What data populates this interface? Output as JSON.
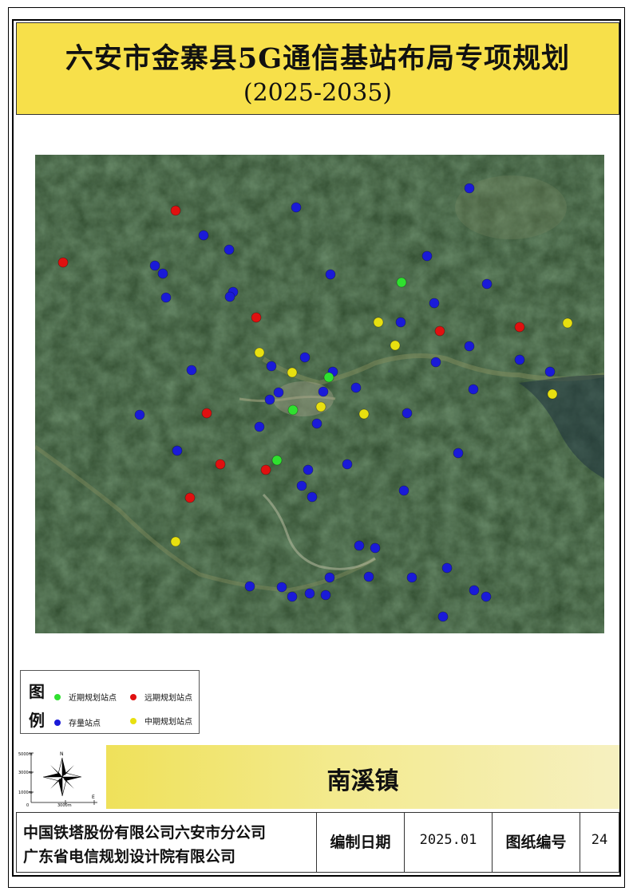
{
  "title": {
    "main": "六安市金寨县5G通信基站布局专项规划",
    "period": "(2025-2035)"
  },
  "colors": {
    "title_bg": "#f7e04a",
    "near_term": "#2fe02f",
    "long_term": "#e01010",
    "existing": "#1a1ad8",
    "mid_term": "#e8e010"
  },
  "legend": {
    "heading_top": "图",
    "heading_bottom": "例",
    "near_term": "近期规划站点",
    "long_term": "远期规划站点",
    "existing": "存量站点",
    "mid_term": "中期规划站点"
  },
  "sites": {
    "existing": [
      [
        588,
        236
      ],
      [
        371,
        260
      ],
      [
        255,
        295
      ],
      [
        287,
        313
      ],
      [
        194,
        333
      ],
      [
        204,
        343
      ],
      [
        414,
        344
      ],
      [
        535,
        321
      ],
      [
        610,
        356
      ],
      [
        208,
        373
      ],
      [
        292,
        366
      ],
      [
        288,
        372
      ],
      [
        544,
        380
      ],
      [
        502,
        404
      ],
      [
        588,
        434
      ],
      [
        382,
        448
      ],
      [
        340,
        459
      ],
      [
        240,
        464
      ],
      [
        546,
        454
      ],
      [
        651,
        451
      ],
      [
        689,
        466
      ],
      [
        417,
        466
      ],
      [
        446,
        486
      ],
      [
        593,
        488
      ],
      [
        405,
        491
      ],
      [
        349,
        492
      ],
      [
        338,
        501
      ],
      [
        175,
        520
      ],
      [
        510,
        518
      ],
      [
        397,
        531
      ],
      [
        325,
        535
      ],
      [
        222,
        565
      ],
      [
        574,
        568
      ],
      [
        435,
        582
      ],
      [
        386,
        589
      ],
      [
        378,
        609
      ],
      [
        391,
        623
      ],
      [
        506,
        615
      ],
      [
        450,
        684
      ],
      [
        470,
        687
      ],
      [
        560,
        712
      ],
      [
        413,
        724
      ],
      [
        462,
        723
      ],
      [
        516,
        724
      ],
      [
        313,
        735
      ],
      [
        353,
        736
      ],
      [
        366,
        748
      ],
      [
        388,
        744
      ],
      [
        408,
        746
      ],
      [
        594,
        740
      ],
      [
        609,
        748
      ],
      [
        555,
        773
      ]
    ],
    "long_term": [
      [
        220,
        264
      ],
      [
        79,
        329
      ],
      [
        321,
        398
      ],
      [
        551,
        415
      ],
      [
        651,
        410
      ],
      [
        259,
        518
      ],
      [
        276,
        582
      ],
      [
        333,
        589
      ],
      [
        238,
        624
      ]
    ],
    "near_term": [
      [
        503,
        354
      ],
      [
        412,
        473
      ],
      [
        367,
        514
      ],
      [
        347,
        577
      ]
    ],
    "mid_term": [
      [
        474,
        404
      ],
      [
        711,
        405
      ],
      [
        495,
        433
      ],
      [
        325,
        442
      ],
      [
        366,
        467
      ],
      [
        402,
        510
      ],
      [
        456,
        519
      ],
      [
        692,
        494
      ],
      [
        220,
        679
      ]
    ]
  },
  "compass": {
    "north": "N",
    "east": "E",
    "scale_y": [
      "5000m",
      "3000m",
      "1000m",
      "0"
    ],
    "scale_x": "3000m"
  },
  "town_name": "南溪镇",
  "footer": {
    "company_1": "中国铁塔股份有限公司六安市分公司",
    "company_2": "广东省电信规划设计院有限公司",
    "date_label": "编制日期",
    "date_value": "2025.01",
    "sheet_label": "图纸编号",
    "sheet_value": "24"
  }
}
